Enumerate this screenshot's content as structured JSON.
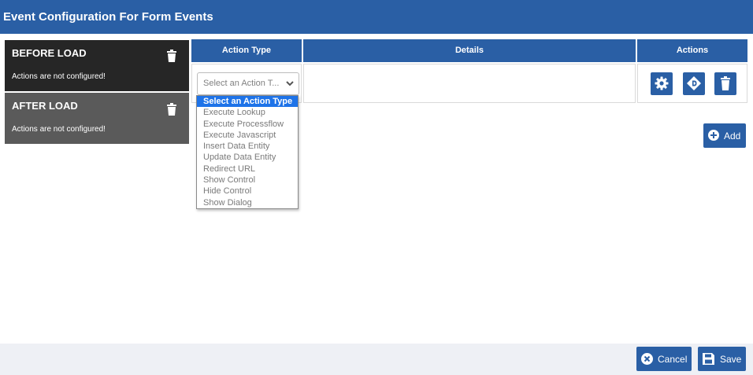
{
  "window": {
    "title": "Event Configuration For Form Events"
  },
  "events": [
    {
      "title": "BEFORE LOAD",
      "subtitle": "Actions are not configured!"
    },
    {
      "title": "AFTER LOAD",
      "subtitle": "Actions are not configured!"
    }
  ],
  "grid": {
    "headers": {
      "action_type": "Action Type",
      "details": "Details",
      "actions": "Actions"
    },
    "row": {
      "select_value": "Select an Action T..."
    }
  },
  "dropdown": {
    "options": [
      "Select an Action Type",
      "Execute Lookup",
      "Execute Processflow",
      "Execute Javascript",
      "Insert Data Entity",
      "Update Data Entity",
      "Redirect URL",
      "Show Control",
      "Hide Control",
      "Show Dialog"
    ],
    "selected_index": 0
  },
  "buttons": {
    "add": "Add",
    "cancel": "Cancel",
    "save": "Save"
  },
  "icons": {
    "event_delete": "trash-icon",
    "row_settings": "gear-icon",
    "row_details": "diamond-icon",
    "row_delete": "trash-icon",
    "add": "plus-circle-icon",
    "cancel": "x-circle-icon",
    "save": "save-icon",
    "select": "chevron-down-icon"
  },
  "colors": {
    "primary": "#2a5fa5",
    "before_load_bg": "#262626",
    "after_load_bg": "#5a5a5a",
    "selected_option": "#1e73e8",
    "footer_bg": "#eef0f5"
  }
}
